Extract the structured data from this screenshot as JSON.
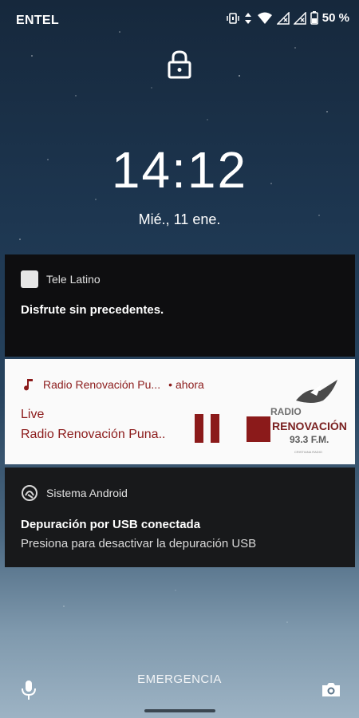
{
  "status_bar": {
    "carrier": "ENTEL",
    "battery_percent": "50 %",
    "icons": [
      "vibrate-icon",
      "data-arrows-icon",
      "wifi-icon",
      "signal-icon",
      "signal-icon",
      "battery-icon"
    ]
  },
  "lockscreen": {
    "lock_icon": "padlock-icon",
    "time": "14:12",
    "date": "Mié., 11 ene."
  },
  "notifications": [
    {
      "app_name": "Tele Latino",
      "title": "Disfrute sin precedentes."
    },
    {
      "app_name": "Radio Renovación Pu...",
      "separator": "•",
      "time": "ahora",
      "title": "Live",
      "subtitle": "Radio Renovación Puna..",
      "accent_color": "#8b1a1a",
      "album_art": {
        "line1": "RADIO",
        "line2": "RENOVACIÓN",
        "line3": "93.3 F.M.",
        "tag": "CRISTIANA RADIO"
      }
    },
    {
      "app_name": "Sistema Android",
      "title": "Depuración por USB conectada",
      "text": "Presiona para desactivar la depuración USB"
    }
  ],
  "bottom": {
    "emergency_label": "EMERGENCIA"
  }
}
